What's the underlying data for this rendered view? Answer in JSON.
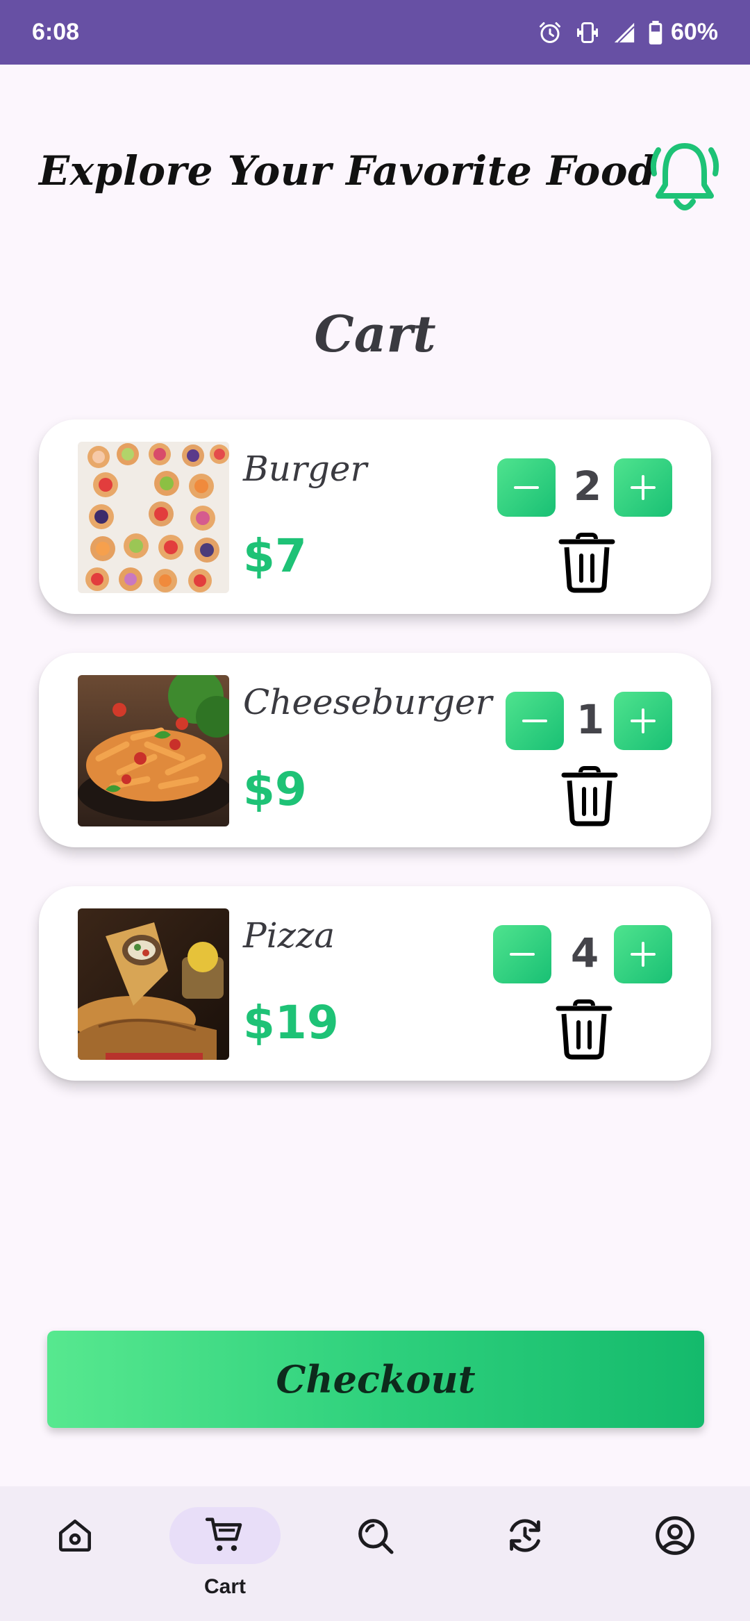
{
  "status_bar": {
    "time": "6:08",
    "battery": "60%"
  },
  "header": {
    "title": "Explore Your Favorite Food",
    "bell_icon": "bell-icon"
  },
  "page": {
    "title": "Cart"
  },
  "cart": {
    "items": [
      {
        "name": "Burger",
        "price": "$7",
        "quantity": "2",
        "thumb": "fruit-tarts-photo"
      },
      {
        "name": "Cheeseburger",
        "price": "$9",
        "quantity": "1",
        "thumb": "pasta-photo"
      },
      {
        "name": "Pizza",
        "price": "$19",
        "quantity": "4",
        "thumb": "wrap-photo"
      }
    ]
  },
  "checkout": {
    "label": "Checkout"
  },
  "nav": {
    "items": [
      {
        "icon": "home-icon",
        "label": ""
      },
      {
        "icon": "cart-icon",
        "label": "Cart"
      },
      {
        "icon": "search-icon",
        "label": ""
      },
      {
        "icon": "history-icon",
        "label": ""
      },
      {
        "icon": "profile-icon",
        "label": ""
      }
    ],
    "active": "Cart"
  },
  "colors": {
    "status_bar": "#6750a4",
    "accent_green": "#1ec276",
    "background": "#fcf6fd",
    "nav_background": "#f2ecf6",
    "nav_active_pill": "#e8def8"
  }
}
